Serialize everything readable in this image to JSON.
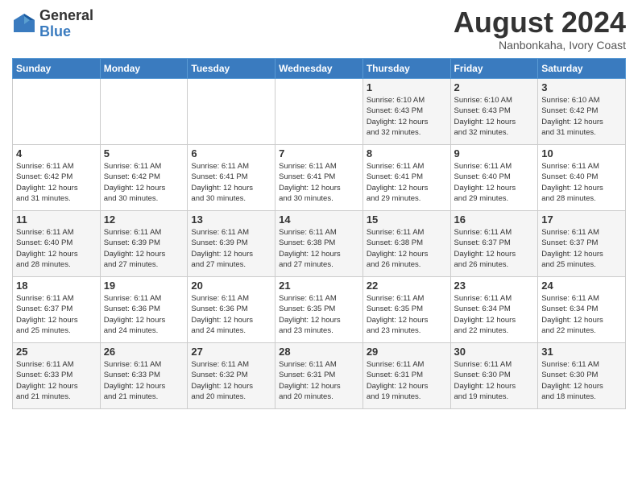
{
  "logo": {
    "general": "General",
    "blue": "Blue"
  },
  "title": "August 2024",
  "location": "Nanbonkaha, Ivory Coast",
  "weekdays": [
    "Sunday",
    "Monday",
    "Tuesday",
    "Wednesday",
    "Thursday",
    "Friday",
    "Saturday"
  ],
  "weeks": [
    [
      {
        "day": "",
        "info": ""
      },
      {
        "day": "",
        "info": ""
      },
      {
        "day": "",
        "info": ""
      },
      {
        "day": "",
        "info": ""
      },
      {
        "day": "1",
        "info": "Sunrise: 6:10 AM\nSunset: 6:43 PM\nDaylight: 12 hours\nand 32 minutes."
      },
      {
        "day": "2",
        "info": "Sunrise: 6:10 AM\nSunset: 6:43 PM\nDaylight: 12 hours\nand 32 minutes."
      },
      {
        "day": "3",
        "info": "Sunrise: 6:10 AM\nSunset: 6:42 PM\nDaylight: 12 hours\nand 31 minutes."
      }
    ],
    [
      {
        "day": "4",
        "info": "Sunrise: 6:11 AM\nSunset: 6:42 PM\nDaylight: 12 hours\nand 31 minutes."
      },
      {
        "day": "5",
        "info": "Sunrise: 6:11 AM\nSunset: 6:42 PM\nDaylight: 12 hours\nand 30 minutes."
      },
      {
        "day": "6",
        "info": "Sunrise: 6:11 AM\nSunset: 6:41 PM\nDaylight: 12 hours\nand 30 minutes."
      },
      {
        "day": "7",
        "info": "Sunrise: 6:11 AM\nSunset: 6:41 PM\nDaylight: 12 hours\nand 30 minutes."
      },
      {
        "day": "8",
        "info": "Sunrise: 6:11 AM\nSunset: 6:41 PM\nDaylight: 12 hours\nand 29 minutes."
      },
      {
        "day": "9",
        "info": "Sunrise: 6:11 AM\nSunset: 6:40 PM\nDaylight: 12 hours\nand 29 minutes."
      },
      {
        "day": "10",
        "info": "Sunrise: 6:11 AM\nSunset: 6:40 PM\nDaylight: 12 hours\nand 28 minutes."
      }
    ],
    [
      {
        "day": "11",
        "info": "Sunrise: 6:11 AM\nSunset: 6:40 PM\nDaylight: 12 hours\nand 28 minutes."
      },
      {
        "day": "12",
        "info": "Sunrise: 6:11 AM\nSunset: 6:39 PM\nDaylight: 12 hours\nand 27 minutes."
      },
      {
        "day": "13",
        "info": "Sunrise: 6:11 AM\nSunset: 6:39 PM\nDaylight: 12 hours\nand 27 minutes."
      },
      {
        "day": "14",
        "info": "Sunrise: 6:11 AM\nSunset: 6:38 PM\nDaylight: 12 hours\nand 27 minutes."
      },
      {
        "day": "15",
        "info": "Sunrise: 6:11 AM\nSunset: 6:38 PM\nDaylight: 12 hours\nand 26 minutes."
      },
      {
        "day": "16",
        "info": "Sunrise: 6:11 AM\nSunset: 6:37 PM\nDaylight: 12 hours\nand 26 minutes."
      },
      {
        "day": "17",
        "info": "Sunrise: 6:11 AM\nSunset: 6:37 PM\nDaylight: 12 hours\nand 25 minutes."
      }
    ],
    [
      {
        "day": "18",
        "info": "Sunrise: 6:11 AM\nSunset: 6:37 PM\nDaylight: 12 hours\nand 25 minutes."
      },
      {
        "day": "19",
        "info": "Sunrise: 6:11 AM\nSunset: 6:36 PM\nDaylight: 12 hours\nand 24 minutes."
      },
      {
        "day": "20",
        "info": "Sunrise: 6:11 AM\nSunset: 6:36 PM\nDaylight: 12 hours\nand 24 minutes."
      },
      {
        "day": "21",
        "info": "Sunrise: 6:11 AM\nSunset: 6:35 PM\nDaylight: 12 hours\nand 23 minutes."
      },
      {
        "day": "22",
        "info": "Sunrise: 6:11 AM\nSunset: 6:35 PM\nDaylight: 12 hours\nand 23 minutes."
      },
      {
        "day": "23",
        "info": "Sunrise: 6:11 AM\nSunset: 6:34 PM\nDaylight: 12 hours\nand 22 minutes."
      },
      {
        "day": "24",
        "info": "Sunrise: 6:11 AM\nSunset: 6:34 PM\nDaylight: 12 hours\nand 22 minutes."
      }
    ],
    [
      {
        "day": "25",
        "info": "Sunrise: 6:11 AM\nSunset: 6:33 PM\nDaylight: 12 hours\nand 21 minutes."
      },
      {
        "day": "26",
        "info": "Sunrise: 6:11 AM\nSunset: 6:33 PM\nDaylight: 12 hours\nand 21 minutes."
      },
      {
        "day": "27",
        "info": "Sunrise: 6:11 AM\nSunset: 6:32 PM\nDaylight: 12 hours\nand 20 minutes."
      },
      {
        "day": "28",
        "info": "Sunrise: 6:11 AM\nSunset: 6:31 PM\nDaylight: 12 hours\nand 20 minutes."
      },
      {
        "day": "29",
        "info": "Sunrise: 6:11 AM\nSunset: 6:31 PM\nDaylight: 12 hours\nand 19 minutes."
      },
      {
        "day": "30",
        "info": "Sunrise: 6:11 AM\nSunset: 6:30 PM\nDaylight: 12 hours\nand 19 minutes."
      },
      {
        "day": "31",
        "info": "Sunrise: 6:11 AM\nSunset: 6:30 PM\nDaylight: 12 hours\nand 18 minutes."
      }
    ]
  ]
}
